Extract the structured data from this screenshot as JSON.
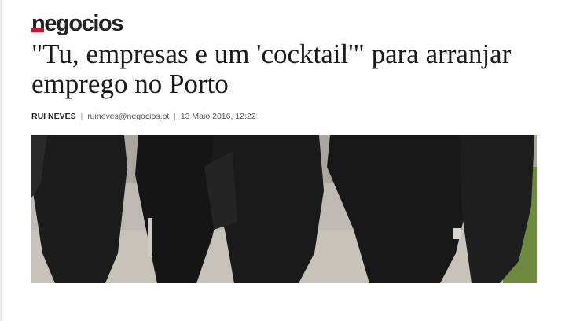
{
  "brand": {
    "logo_text": "negocios",
    "accent_color": "#d0112b"
  },
  "article": {
    "title": "\"Tu, empresas e um 'cocktail'\" para arranjar emprego no Porto",
    "author": "RUI NEVES",
    "email": "ruineves@negocios.pt",
    "date": "13 Maio 2016, 12:22",
    "byline_separator": "|"
  },
  "photo": {
    "icon": "students-in-capes-photo"
  }
}
